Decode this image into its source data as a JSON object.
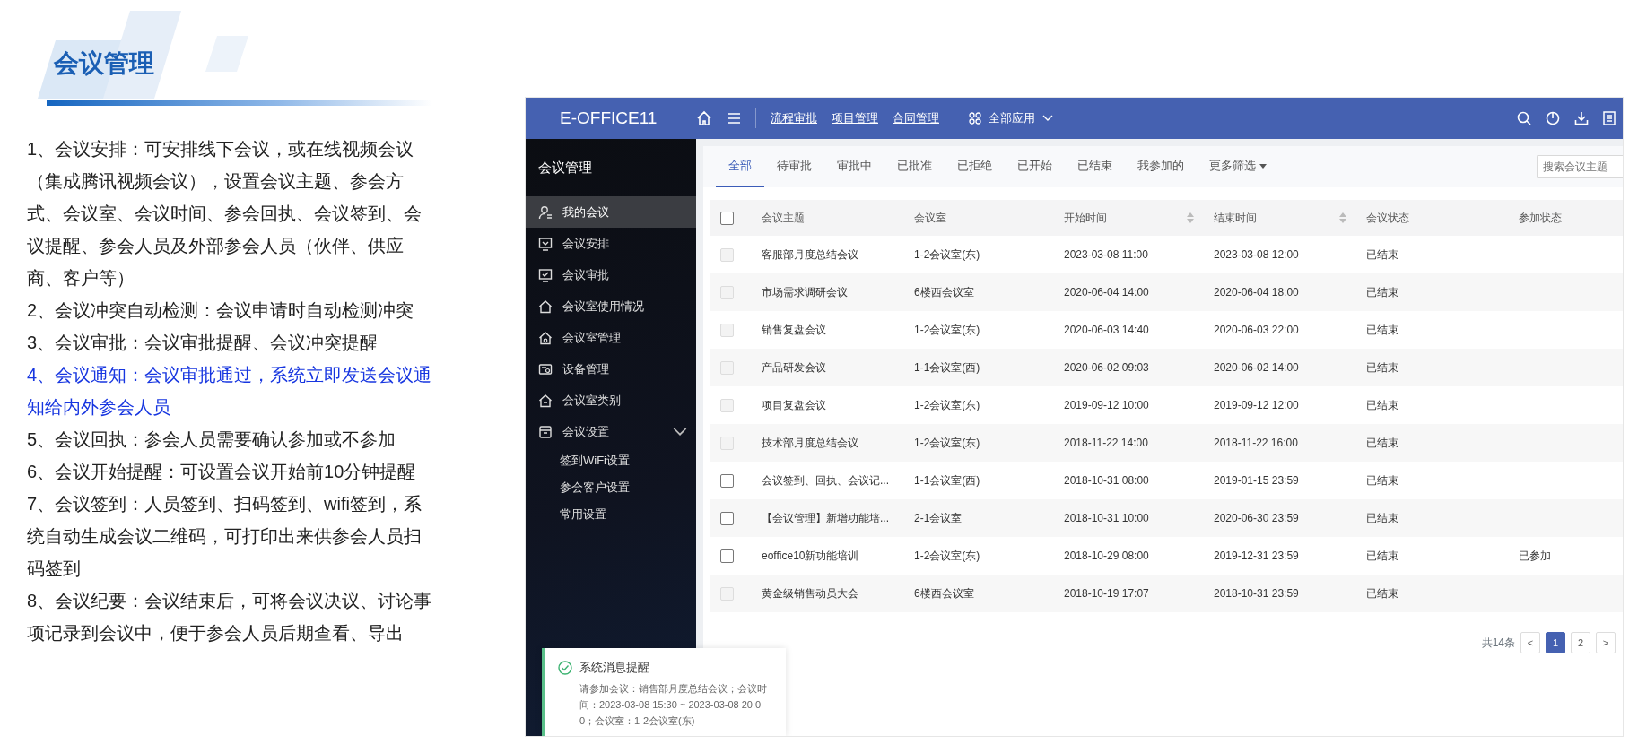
{
  "slide": {
    "title": "会议管理",
    "points": [
      {
        "text": "1、会议安排：可安排线下会议，或在线视频会议（集成腾讯视频会议），设置会议主题、参会方式、会议室、会议时间、参会回执、会议签到、会议提醒、参会人员及外部参会人员（伙伴、供应商、客户等）",
        "highlighted": false
      },
      {
        "text": "2、会议冲突自动检测：会议申请时自动检测冲突",
        "highlighted": false
      },
      {
        "text": "3、会议审批：会议审批提醒、会议冲突提醒",
        "highlighted": false
      },
      {
        "text": "4、会议通知：会议审批通过，系统立即发送会议通知给内外参会人员",
        "highlighted": true
      },
      {
        "text": "5、会议回执：参会人员需要确认参加或不参加",
        "highlighted": false
      },
      {
        "text": "6、会议开始提醒：可设置会议开始前10分钟提醒",
        "highlighted": false
      },
      {
        "text": "7、会议签到：人员签到、扫码签到、wifi签到，系统自动生成会议二维码，可打印出来供参会人员扫码签到",
        "highlighted": false
      },
      {
        "text": "8、会议纪要：会议结束后，可将会议决议、讨论事项记录到会议中，便于参会人员后期查看、导出",
        "highlighted": false
      }
    ]
  },
  "app": {
    "brand": "E-OFFICE11",
    "nav_links": [
      "流程审批",
      "项目管理",
      "合同管理"
    ],
    "apps_menu": "全部应用",
    "sidebar": {
      "title": "会议管理",
      "items": [
        {
          "label": "我的会议",
          "selected": true
        },
        {
          "label": "会议安排",
          "selected": false
        },
        {
          "label": "会议审批",
          "selected": false
        },
        {
          "label": "会议室使用情况",
          "selected": false
        },
        {
          "label": "会议室管理",
          "selected": false
        },
        {
          "label": "设备管理",
          "selected": false
        },
        {
          "label": "会议室类别",
          "selected": false
        },
        {
          "label": "会议设置",
          "selected": false,
          "expanded": true,
          "children": [
            {
              "label": "签到WiFi设置",
              "selected": false
            },
            {
              "label": "参会客户设置",
              "selected": false
            },
            {
              "label": "常用设置",
              "selected": false
            }
          ]
        }
      ]
    },
    "tabs": [
      {
        "label": "全部",
        "selected": true
      },
      {
        "label": "待审批",
        "selected": false
      },
      {
        "label": "审批中",
        "selected": false
      },
      {
        "label": "已批准",
        "selected": false
      },
      {
        "label": "已拒绝",
        "selected": false
      },
      {
        "label": "已开始",
        "selected": false
      },
      {
        "label": "已结束",
        "selected": false
      },
      {
        "label": "我参加的",
        "selected": false
      }
    ],
    "more_filter": "更多筛选",
    "search": {
      "placeholder": "搜索会议主题"
    },
    "table": {
      "header_checked": false,
      "columns": [
        {
          "label": "会议主题",
          "sortable": false
        },
        {
          "label": "会议室",
          "sortable": false
        },
        {
          "label": "开始时间",
          "sortable": true
        },
        {
          "label": "结束时间",
          "sortable": true
        },
        {
          "label": "会议状态",
          "sortable": false
        },
        {
          "label": "参加状态",
          "sortable": false
        }
      ],
      "rows": [
        {
          "checked": false,
          "disabled": true,
          "cells": [
            "客服部月度总结会议",
            "1-2会议室(东)",
            "2023-03-08 11:00",
            "2023-03-08 12:00",
            "已结束",
            ""
          ]
        },
        {
          "checked": false,
          "disabled": true,
          "cells": [
            "市场需求调研会议",
            "6楼西会议室",
            "2020-06-04 14:00",
            "2020-06-04 18:00",
            "已结束",
            ""
          ]
        },
        {
          "checked": false,
          "disabled": true,
          "cells": [
            "销售复盘会议",
            "1-2会议室(东)",
            "2020-06-03 14:40",
            "2020-06-03 22:00",
            "已结束",
            ""
          ]
        },
        {
          "checked": false,
          "disabled": true,
          "cells": [
            "产品研发会议",
            "1-1会议室(西)",
            "2020-06-02 09:03",
            "2020-06-02 14:00",
            "已结束",
            ""
          ]
        },
        {
          "checked": false,
          "disabled": true,
          "cells": [
            "项目复盘会议",
            "1-2会议室(东)",
            "2019-09-12 10:00",
            "2019-09-12 12:00",
            "已结束",
            ""
          ]
        },
        {
          "checked": false,
          "disabled": true,
          "cells": [
            "技术部月度总结会议",
            "1-2会议室(东)",
            "2018-11-22 14:00",
            "2018-11-22 16:00",
            "已结束",
            ""
          ]
        },
        {
          "checked": false,
          "disabled": false,
          "cells": [
            "会议签到、回执、会议记...",
            "1-1会议室(西)",
            "2018-10-31 08:00",
            "2019-01-15 23:59",
            "已结束",
            ""
          ]
        },
        {
          "checked": false,
          "disabled": false,
          "cells": [
            "【会议管理】新增功能培...",
            "2-1会议室",
            "2018-10-31 10:00",
            "2020-06-30 23:59",
            "已结束",
            ""
          ]
        },
        {
          "checked": false,
          "disabled": false,
          "cells": [
            "eoffice10新功能培训",
            "1-2会议室(东)",
            "2018-10-29 08:00",
            "2019-12-31 23:59",
            "已结束",
            "已参加"
          ]
        },
        {
          "checked": false,
          "disabled": true,
          "cells": [
            "黄金级销售动员大会",
            "6楼西会议室",
            "2018-10-19 17:07",
            "2018-10-31 23:59",
            "已结束",
            ""
          ]
        }
      ]
    },
    "pagination": {
      "total": "共14条",
      "prev": "<",
      "pages": [
        {
          "label": "1",
          "selected": true
        },
        {
          "label": "2",
          "selected": false
        }
      ],
      "next": ">"
    },
    "toast": {
      "title": "系统消息提醒",
      "message": "请参加会议：销售部月度总结会议；会议时间：2023-03-08 15:30 ~ 2023-03-08 20:00；会议室：1-2会议室(东)"
    }
  }
}
